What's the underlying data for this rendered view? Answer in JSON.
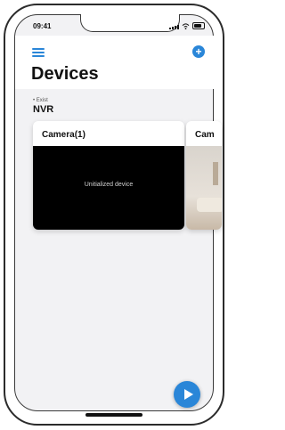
{
  "status_bar": {
    "time": "09:41"
  },
  "header": {
    "title": "Devices",
    "menu_icon": "menu-icon",
    "add_icon": "add-icon"
  },
  "group": {
    "caption": "• Exist",
    "name": "NVR"
  },
  "cards": [
    {
      "title": "Camera(1)",
      "media_text": "Unitialized device"
    },
    {
      "title": "Cam"
    }
  ],
  "colors": {
    "accent": "#2a86d8",
    "screen_bg": "#f2f2f4",
    "card_media_bg": "#000000"
  }
}
